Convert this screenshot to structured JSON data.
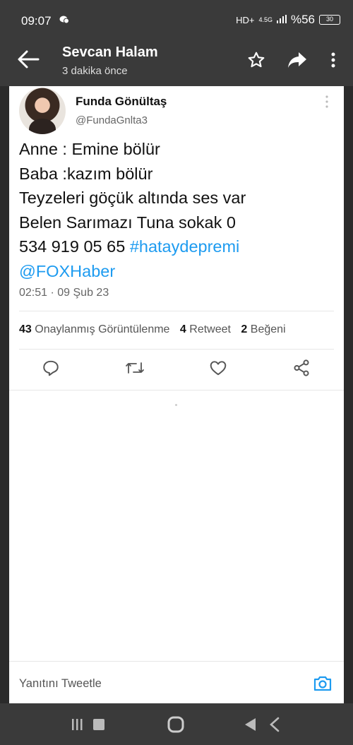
{
  "status_bar": {
    "time": "09:07",
    "network": "HD+",
    "signal_type": "4.5G",
    "battery_percent": "%56",
    "battery_level": "30"
  },
  "app_bar": {
    "title": "Sevcan Halam",
    "subtitle": "3 dakika önce"
  },
  "tweet": {
    "author_name": "Funda Gönültaş",
    "author_handle": "@FundaGnlta3",
    "lines": [
      "Anne : Emine bölür",
      "Baba :kazım bölür",
      "Teyzeleri göçük altında ses var",
      "Belen Sarımazı Tuna sokak 0",
      "534 919 05 65 "
    ],
    "hashtag": "#hataydepremi",
    "mention": "@FOXHaber",
    "timestamp": "02:51 · 09 Şub 23",
    "views_count": "43",
    "views_label": "Onaylanmış Görüntülenme",
    "retweets_count": "4",
    "retweets_label": "Retweet",
    "likes_count": "2",
    "likes_label": "Beğeni"
  },
  "reply": {
    "placeholder": "Yanıtını Tweetle"
  },
  "colors": {
    "link": "#1d9bf0",
    "bar": "#3a3a3a"
  }
}
